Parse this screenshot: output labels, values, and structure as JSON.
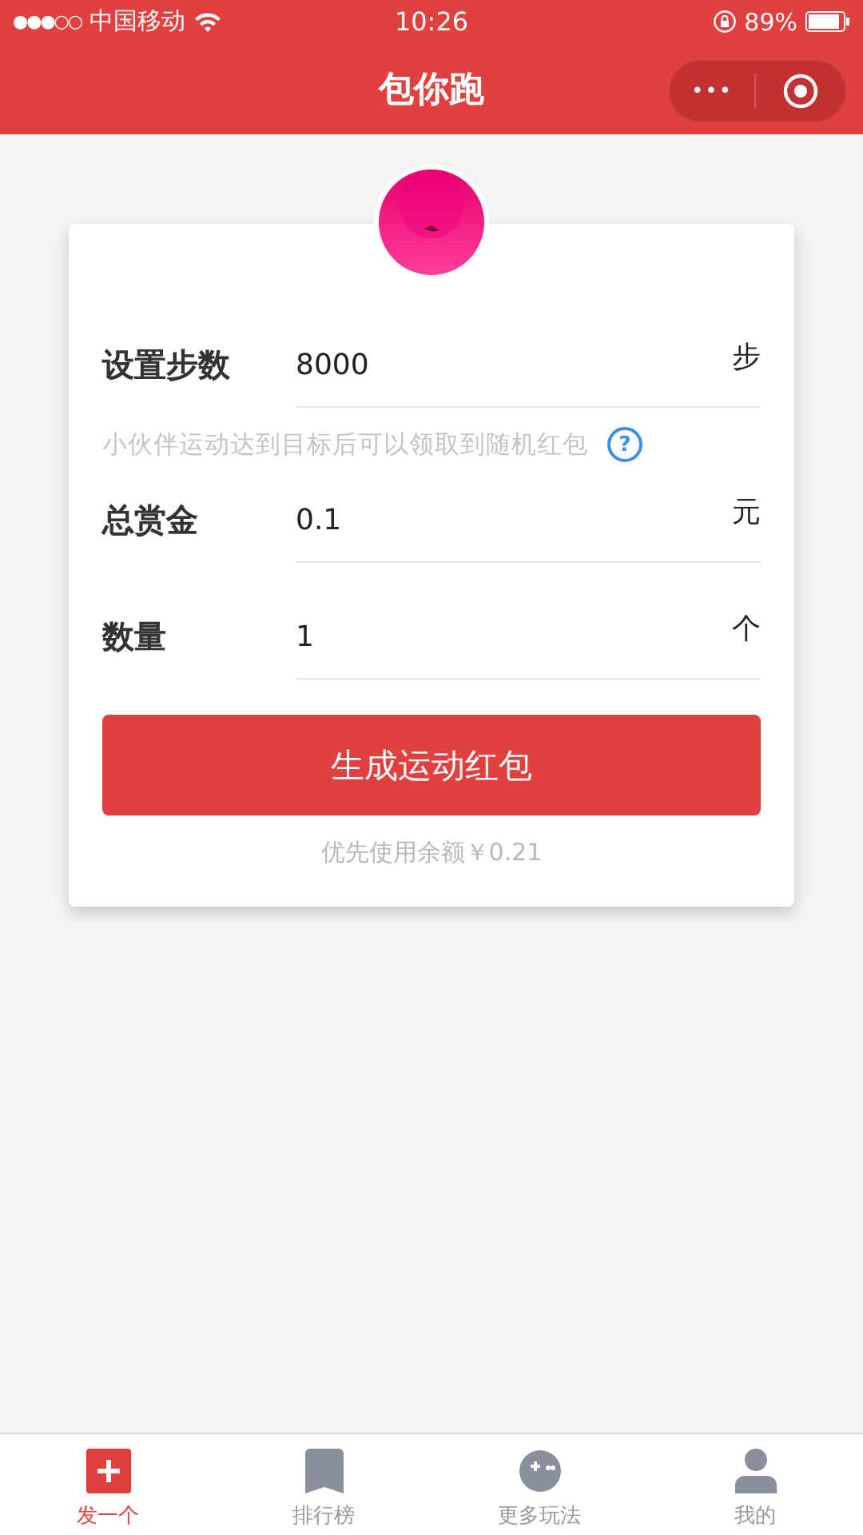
{
  "status_bar": {
    "signal_text": "●●●○○",
    "carrier": "中国移动",
    "time": "10:26",
    "battery": "89%"
  },
  "nav": {
    "title": "包你跑",
    "more": "•••"
  },
  "fields": [
    {
      "label": "设置步数",
      "value": "8000",
      "unit": "步"
    },
    {
      "label": "总赏金",
      "value": "0.1",
      "unit": "元"
    },
    {
      "label": "数量",
      "value": "1",
      "unit": "个"
    }
  ],
  "hint": "小伙伴运动达到目标后可以领取到随机红包",
  "help": "?",
  "submit": "生成运动红包",
  "balance_note": "优先使用余额￥0.21",
  "tabs": [
    {
      "label": "发一个",
      "kind": "plus",
      "selected": true
    },
    {
      "label": "排行榜",
      "kind": "bookmark",
      "selected": false
    },
    {
      "label": "更多玩法",
      "kind": "game",
      "selected": false
    },
    {
      "label": "我的",
      "kind": "person",
      "selected": false
    }
  ]
}
